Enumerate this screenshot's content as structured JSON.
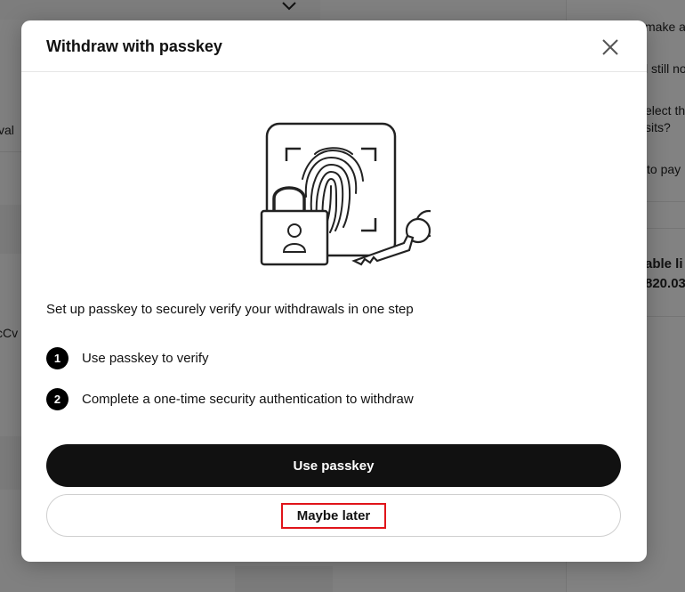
{
  "background": {
    "fragments": [
      {
        "text": "make a"
      },
      {
        "text": "l still no"
      },
      {
        "text": "elect th"
      },
      {
        "text": "sits?"
      },
      {
        "text": "to pay"
      },
      {
        "text": "able li"
      },
      {
        "text": "820.03"
      },
      {
        "text": "val"
      },
      {
        "text": "cCv"
      }
    ]
  },
  "modal": {
    "title": "Withdraw with passkey",
    "intro": "Set up passkey to securely verify your withdrawals in one step",
    "steps": [
      {
        "number": "1",
        "text": "Use passkey to verify"
      },
      {
        "number": "2",
        "text": "Complete a one-time security authentication to withdraw"
      }
    ],
    "primary_button": "Use passkey",
    "secondary_button": "Maybe later"
  },
  "colors": {
    "primary": "#111111",
    "highlight": "#e0141a"
  },
  "icons": [
    "close-icon",
    "fingerprint-icon",
    "lock-icon",
    "key-icon",
    "chevron-down-icon"
  ]
}
